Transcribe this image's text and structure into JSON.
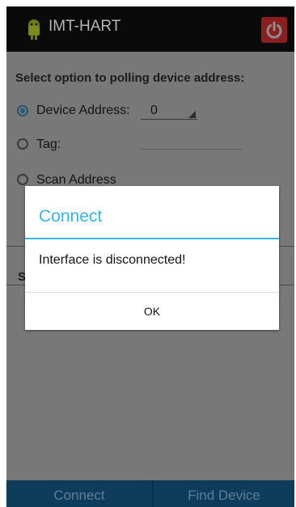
{
  "app": {
    "title": "IMT-HART",
    "app_icon": "android-robot-icon",
    "power_icon": "power-icon",
    "power_color": "#8a1f1f"
  },
  "polling": {
    "section_title": "Select option to polling device address:",
    "options": [
      {
        "label": "Device Address:",
        "checked": true
      },
      {
        "label": "Tag:",
        "checked": false
      },
      {
        "label": "Scan Address",
        "checked": false
      }
    ],
    "device_address_value": "0",
    "tag_value": ""
  },
  "hidden_section_initial": "S",
  "bottom_buttons": {
    "connect": "Connect",
    "find_device": "Find Device"
  },
  "dialog": {
    "title": "Connect",
    "message": "Interface is disconnected!",
    "ok_label": "OK",
    "accent_color": "#33b5e5"
  }
}
